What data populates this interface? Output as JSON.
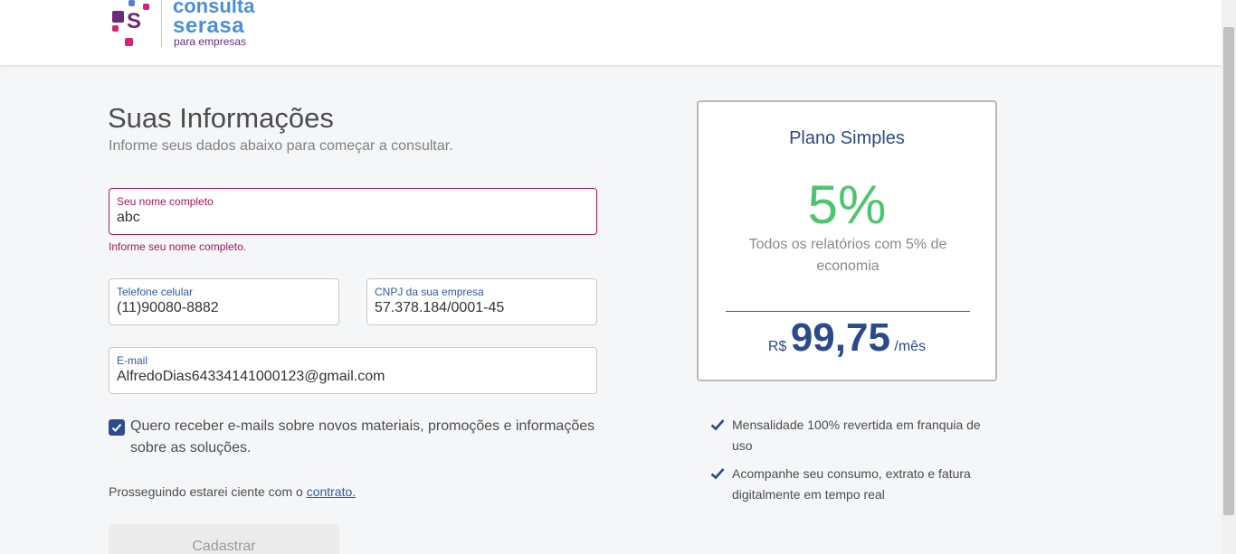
{
  "header": {
    "brand_line1": "consulta",
    "brand_line2": "serasa",
    "brand_line3": "para empresas",
    "logo_letter": "S"
  },
  "form": {
    "title": "Suas Informações",
    "subtitle": "Informe seus dados abaixo para começar a consultar.",
    "name_label": "Seu nome completo",
    "name_value": "abc",
    "name_error": "Informe seu nome completo.",
    "phone_label": "Telefone celular",
    "phone_value": "(11)90080-8882",
    "cnpj_label": "CNPJ da sua empresa",
    "cnpj_value": "57.378.184/0001-45",
    "email_label": "E-mail",
    "email_value": "AlfredoDias64334141000123@gmail.com",
    "optin_checked": true,
    "optin_text": "Quero receber e-mails sobre novos materiais, promoções e informações sobre as soluções.",
    "terms_text": "Prosseguindo estarei ciente com o ",
    "terms_link": "contrato.",
    "submit_label": "Cadastrar"
  },
  "plan": {
    "name": "Plano Simples",
    "percent": "5%",
    "description": "Todos os relatórios com 5% de economia",
    "currency": "R$",
    "price": "99,75",
    "period": "/mês"
  },
  "benefits": [
    {
      "text": "Mensalidade 100% revertida em franquia de uso",
      "icon": "check-icon"
    },
    {
      "text": "Acompanhe seu consumo, extrato e fatura digitalmente em tempo real",
      "icon": "check-icon"
    }
  ],
  "colors": {
    "accent_blue": "#2e5aa6",
    "error": "#a3195b",
    "plan_green": "#4cc56e",
    "plan_navy": "#2b4a8a"
  }
}
